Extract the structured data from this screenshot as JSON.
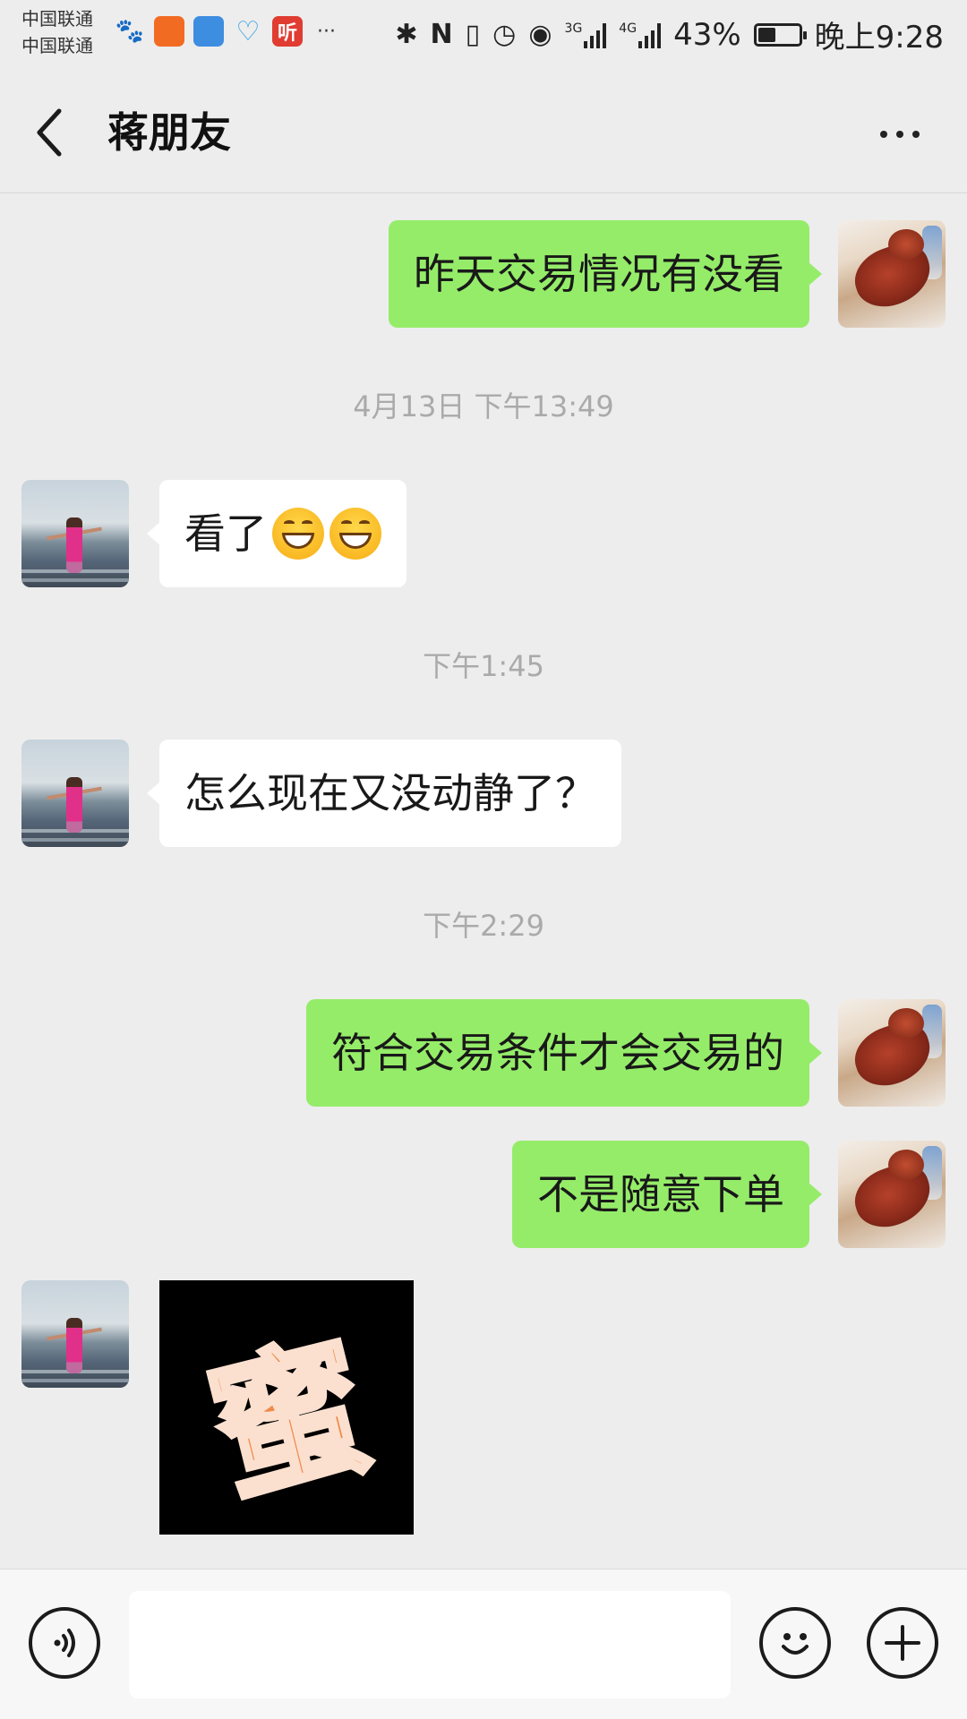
{
  "status_bar": {
    "carrier_1": "中国联通",
    "carrier_2": "中国联通",
    "notif_listen": "听",
    "more": "···",
    "network_1": "3G",
    "network_2": "4G",
    "battery_percent": "43%",
    "battery_level": 0.43,
    "time": "晚上9:28"
  },
  "header": {
    "title": "蒋朋友"
  },
  "messages": [
    {
      "side": "self",
      "text": "昨天交易情况有没看"
    },
    {
      "type": "timestamp",
      "text": "4月13日 下午13:49"
    },
    {
      "side": "other",
      "text": "看了",
      "emoji": "grinning-face-icon"
    },
    {
      "type": "timestamp",
      "text": "下午1:45"
    },
    {
      "side": "other",
      "text": "怎么现在又没动静了？"
    },
    {
      "type": "timestamp",
      "text": "下午2:29"
    },
    {
      "side": "self",
      "text": "符合交易条件才会交易的"
    },
    {
      "side": "self",
      "text": "不是随意下单"
    },
    {
      "side": "other",
      "type": "sticker",
      "text": "蜜"
    }
  ],
  "input_bar": {
    "placeholder": "",
    "voice_icon": "voice-icon",
    "emoji_icon": "emoji-icon",
    "plus_icon": "plus-icon"
  },
  "colors": {
    "self_bubble": "#95ec69",
    "other_bubble": "#ffffff",
    "background": "#ededed"
  }
}
